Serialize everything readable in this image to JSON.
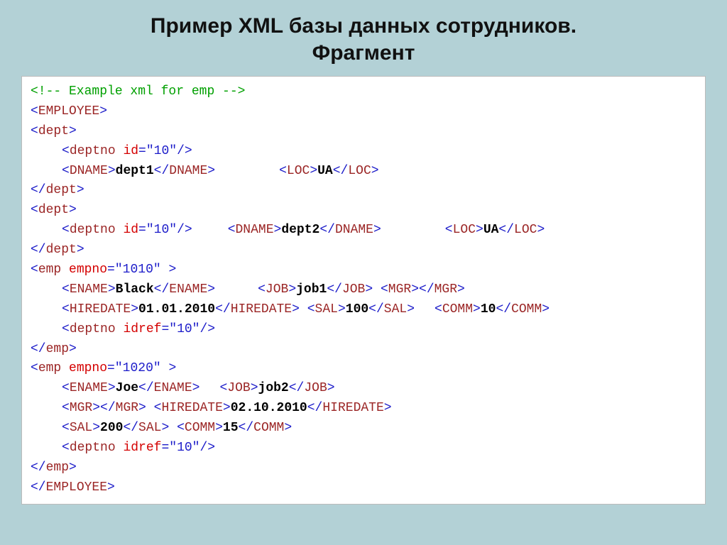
{
  "title_line1": "Пример XML базы данных сотрудников.",
  "title_line2": "Фрагмент",
  "comment_text": "<!-- Example xml for emp -->",
  "tag_employee_open": "EMPLOYEE",
  "tag_employee_close": "EMPLOYEE",
  "dept1": {
    "tag": "dept",
    "deptno_attr": "id",
    "deptno_val": "\"10\"",
    "dname_tag": "DNAME",
    "dname_text": "dept1",
    "loc_tag": "LOC",
    "loc_text": "UA"
  },
  "dept2": {
    "tag": "dept",
    "deptno_attr": "id",
    "deptno_val": "\"10\"",
    "dname_tag": "DNAME",
    "dname_text": "dept2",
    "loc_tag": "LOC",
    "loc_text": "UA"
  },
  "emp1": {
    "tag": "emp",
    "empno_attr": "empno",
    "empno_val": "\"1010\"",
    "ename_tag": "ENAME",
    "ename_text": "Black",
    "job_tag": "JOB",
    "job_text": "job1",
    "mgr_tag": "MGR",
    "mgr_text": "",
    "hiredate_tag": "HIREDATE",
    "hiredate_text": "01.01.2010",
    "sal_tag": "SAL",
    "sal_text": "100",
    "comm_tag": "COMM",
    "comm_text": "10",
    "deptno_tag": "deptno",
    "deptno_attr": "idref",
    "deptno_val": "\"10\""
  },
  "emp2": {
    "tag": "emp",
    "empno_attr": "empno",
    "empno_val": "\"1020\"",
    "ename_tag": "ENAME",
    "ename_text": "Joe",
    "job_tag": "JOB",
    "job_text": "job2",
    "mgr_tag": "MGR",
    "mgr_text": "",
    "hiredate_tag": "HIREDATE",
    "hiredate_text": "02.10.2010",
    "sal_tag": "SAL",
    "sal_text": "200",
    "comm_tag": "COMM",
    "comm_text": "15",
    "deptno_tag": "deptno",
    "deptno_attr": "idref",
    "deptno_val": "\"10\""
  }
}
